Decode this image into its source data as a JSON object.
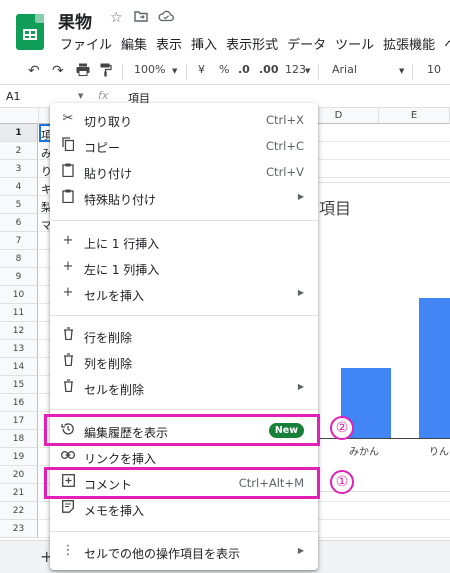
{
  "doc": {
    "title": "果物"
  },
  "menubar": [
    "ファイル",
    "編集",
    "表示",
    "挿入",
    "表示形式",
    "データ",
    "ツール",
    "拡張機能",
    "ヘ"
  ],
  "toolbar": {
    "zoom": "100%",
    "currency": "¥",
    "percent": "%",
    "dec_less": ".0",
    "dec_more": ".00",
    "format_more": "123",
    "font": "Arial",
    "font_size": "10"
  },
  "formula": {
    "cell_ref": "A1",
    "fx": "fx",
    "content": "項目"
  },
  "columns": {
    "d": "D",
    "e": "E"
  },
  "rows": [
    "1",
    "2",
    "3",
    "4",
    "5",
    "6",
    "7",
    "8",
    "9",
    "10",
    "11",
    "12",
    "13",
    "14",
    "15",
    "16",
    "17",
    "18",
    "19",
    "20",
    "21",
    "22",
    "23"
  ],
  "cells": [
    "項",
    "み",
    "り",
    "キ",
    "梨",
    "マ"
  ],
  "chart": {
    "title_fragment": "項目",
    "categories": [
      "みかん",
      "りん"
    ]
  },
  "chart_data": {
    "type": "bar",
    "title": "項目",
    "categories": [
      "みかん",
      "りん"
    ],
    "values": [
      0.45,
      0.9
    ],
    "note": "values are relative heights; chart is partially occluded by menu"
  },
  "menu": {
    "cut": {
      "label": "切り取り",
      "shortcut": "Ctrl+X"
    },
    "copy": {
      "label": "コピー",
      "shortcut": "Ctrl+C"
    },
    "paste": {
      "label": "貼り付け",
      "shortcut": "Ctrl+V"
    },
    "paste_special": {
      "label": "特殊貼り付け"
    },
    "insert_row": {
      "label": "上に 1 行挿入"
    },
    "insert_col": {
      "label": "左に 1 列挿入"
    },
    "insert_cells": {
      "label": "セルを挿入"
    },
    "delete_row": {
      "label": "行を削除"
    },
    "delete_col": {
      "label": "列を削除"
    },
    "delete_cells": {
      "label": "セルを削除"
    },
    "edit_history": {
      "label": "編集履歴を表示",
      "badge": "New"
    },
    "link": {
      "label": "リンクを挿入"
    },
    "comment": {
      "label": "コメント",
      "shortcut": "Ctrl+Alt+M"
    },
    "memo": {
      "label": "メモを挿入"
    },
    "more": {
      "label": "セルでの他の操作項目を表示"
    }
  },
  "annotations": {
    "one": "①",
    "two": "②"
  },
  "colors": {
    "highlight": "#e020b8",
    "bar": "#4285f4",
    "badge": "#188038",
    "sheets_green": "#0f9d58"
  }
}
